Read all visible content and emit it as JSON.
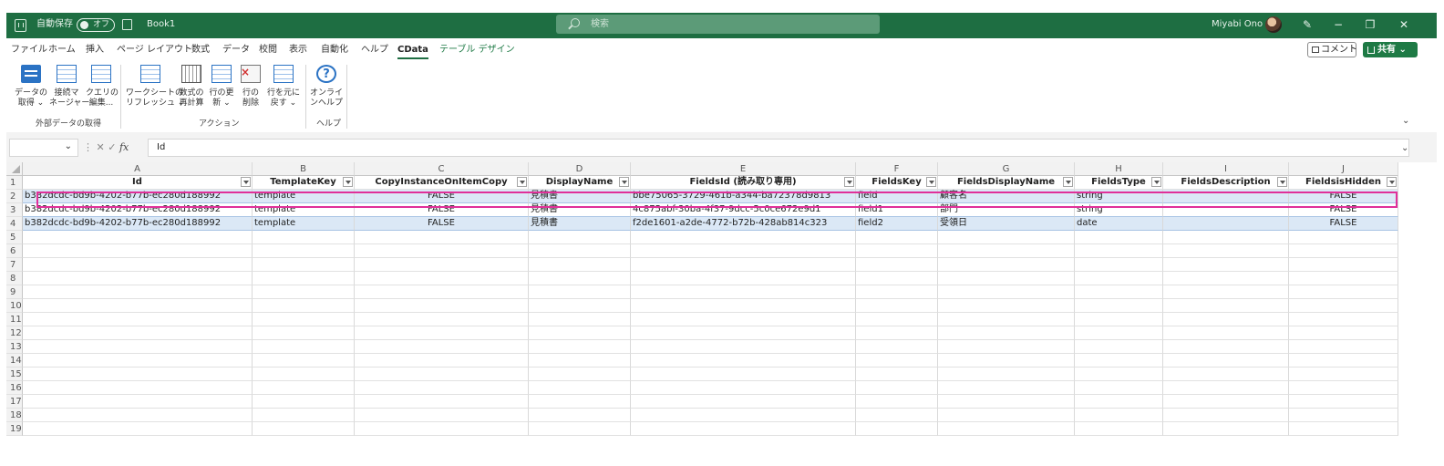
{
  "titlebar": {
    "autosave_label": "自動保存",
    "autosave_state": "オフ",
    "filename": "Book1",
    "search_placeholder": "検索",
    "user_name": "Miyabi Ono"
  },
  "menu": {
    "tabs": [
      "ファイル",
      "ホーム",
      "挿入",
      "ページ レイアウト",
      "数式",
      "データ",
      "校閲",
      "表示",
      "自動化",
      "ヘルプ",
      "CData",
      "テーブル デザイン"
    ],
    "active_tab": "CData",
    "comment_label": "コメント",
    "share_label": "共有"
  },
  "ribbon": {
    "groups": [
      {
        "label": "外部データの取得",
        "buttons": [
          {
            "line1": "データの",
            "line2": "取得 ⌄",
            "icon": "get-data-icon"
          },
          {
            "line1": "接続マ",
            "line2": "ネージャー",
            "icon": "connection-manager-icon"
          },
          {
            "line1": "クエリの",
            "line2": "編集...",
            "icon": "edit-query-icon"
          }
        ]
      },
      {
        "label": "アクション",
        "buttons": [
          {
            "line1": "ワークシートの",
            "line2": "リフレッシュ ⌄",
            "icon": "refresh-worksheet-icon"
          },
          {
            "line1": "数式の",
            "line2": "再計算",
            "icon": "recalc-formula-icon"
          },
          {
            "line1": "行の更",
            "line2": "新 ⌄",
            "icon": "update-rows-icon"
          },
          {
            "line1": "行の",
            "line2": "削除",
            "icon": "delete-rows-icon"
          },
          {
            "line1": "行を元に",
            "line2": "戻す ⌄",
            "icon": "revert-rows-icon"
          }
        ]
      },
      {
        "label": "ヘルプ",
        "buttons": [
          {
            "line1": "オンライ",
            "line2": "ンヘルプ",
            "icon": "online-help-icon"
          }
        ]
      }
    ]
  },
  "formula_bar": {
    "name_box": "",
    "content": "Id"
  },
  "sheet": {
    "columns": [
      "A",
      "B",
      "C",
      "D",
      "E",
      "F",
      "G",
      "H",
      "I",
      "J"
    ],
    "headers": [
      "Id",
      "TemplateKey",
      "CopyInstanceOnItemCopy",
      "DisplayName",
      "FieldsId (読み取り専用)",
      "FieldsKey",
      "FieldsDisplayName",
      "FieldsType",
      "FieldsDescription",
      "FieldsisHidden"
    ],
    "rows": [
      [
        "b382dcdc-bd9b-4202-b77b-ec280d188992",
        "template",
        "FALSE",
        "見積書",
        "bbe75065-3729-461b-a344-ba72378d9813",
        "field",
        "顧客名",
        "string",
        "",
        "FALSE"
      ],
      [
        "b382dcdc-bd9b-4202-b77b-ec280d188992",
        "template",
        "FALSE",
        "見積書",
        "4c875abf-30ba-4f37-9dcc-5c0ce672e9d1",
        "field1",
        "部門",
        "string",
        "",
        "FALSE"
      ],
      [
        "b382dcdc-bd9b-4202-b77b-ec280d188992",
        "template",
        "FALSE",
        "見積書",
        "f2de1601-a2de-4772-b72b-428ab814c323",
        "field2",
        "受領日",
        "date",
        "",
        "FALSE"
      ]
    ],
    "row_numbers": [
      "1",
      "2",
      "3",
      "4",
      "5",
      "6",
      "7",
      "8",
      "9",
      "10",
      "11",
      "12",
      "13",
      "14",
      "15",
      "16",
      "17",
      "18",
      "19"
    ]
  },
  "colors": {
    "title_green": "#1e6e42",
    "band_blue": "#dbe8f6",
    "highlight_pink": "#e0309a"
  }
}
